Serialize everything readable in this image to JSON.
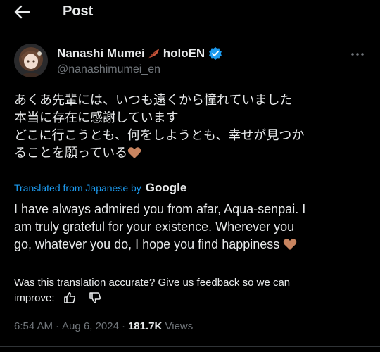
{
  "header": {
    "title": "Post"
  },
  "author": {
    "name": "Nanashi Mumei",
    "name_suffix": "holoEN",
    "handle": "@nanashimumei_en",
    "verified": true
  },
  "post": {
    "original_lines": [
      "あくあ先輩には、いつも遠くから憧れていました",
      "本当に存在に感謝しています",
      "どこに行こうとも、何をしようとも、幸せが見つか",
      "ることを願っている"
    ],
    "translated_from": "Translated from Japanese by",
    "translator": "Google",
    "translation_lines": [
      "I have always admired you from afar, Aqua-senpai. I",
      "am truly grateful for your existence. Wherever you",
      "go, whatever you do, I hope you find happiness"
    ],
    "feedback_line1": "Was this translation accurate? Give us feedback so we can",
    "feedback_line2": "improve:"
  },
  "meta": {
    "time": "6:54 AM",
    "date": "Aug 6, 2024",
    "views_count": "181.7K",
    "views_label": "Views",
    "separator": "·"
  },
  "colors": {
    "background": "#000000",
    "text": "#e7e9ea",
    "muted": "#71767b",
    "link": "#1d9bf0",
    "verified": "#1d9bf0",
    "heart": "#c8845f"
  }
}
